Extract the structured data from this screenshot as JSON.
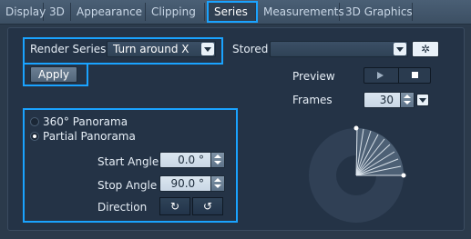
{
  "tabs": {
    "items": [
      {
        "label": "Display"
      },
      {
        "label": "3D"
      },
      {
        "label": "Appearance"
      },
      {
        "label": "Clipping"
      },
      {
        "label": "Series"
      },
      {
        "label": "Measurements"
      },
      {
        "label": "3D Graphics"
      }
    ],
    "active": "Series"
  },
  "series_panel": {
    "render_series_label": "Render Series",
    "render_series_value": "Turn around X",
    "stored_label": "Stored",
    "stored_value": "",
    "apply_label": "Apply",
    "preview_label": "Preview",
    "frames_label": "Frames",
    "frames_value": "30",
    "panorama_360_label": "360° Panorama",
    "partial_panorama_label": "Partial Panorama",
    "start_angle_label": "Start Angle",
    "start_angle_value": "0.0 °",
    "stop_angle_label": "Stop Angle",
    "stop_angle_value": "90.0 °",
    "direction_label": "Direction",
    "direction_cw_icon": "↻",
    "direction_ccw_icon": "↺",
    "gear_icon": "✲"
  },
  "colors": {
    "highlight": "#1aa3ff",
    "panel_bg": "#243346",
    "tab_bg": "#3c4f63"
  },
  "selection": {
    "panorama_mode": "Partial Panorama",
    "direction": "clockwise"
  }
}
